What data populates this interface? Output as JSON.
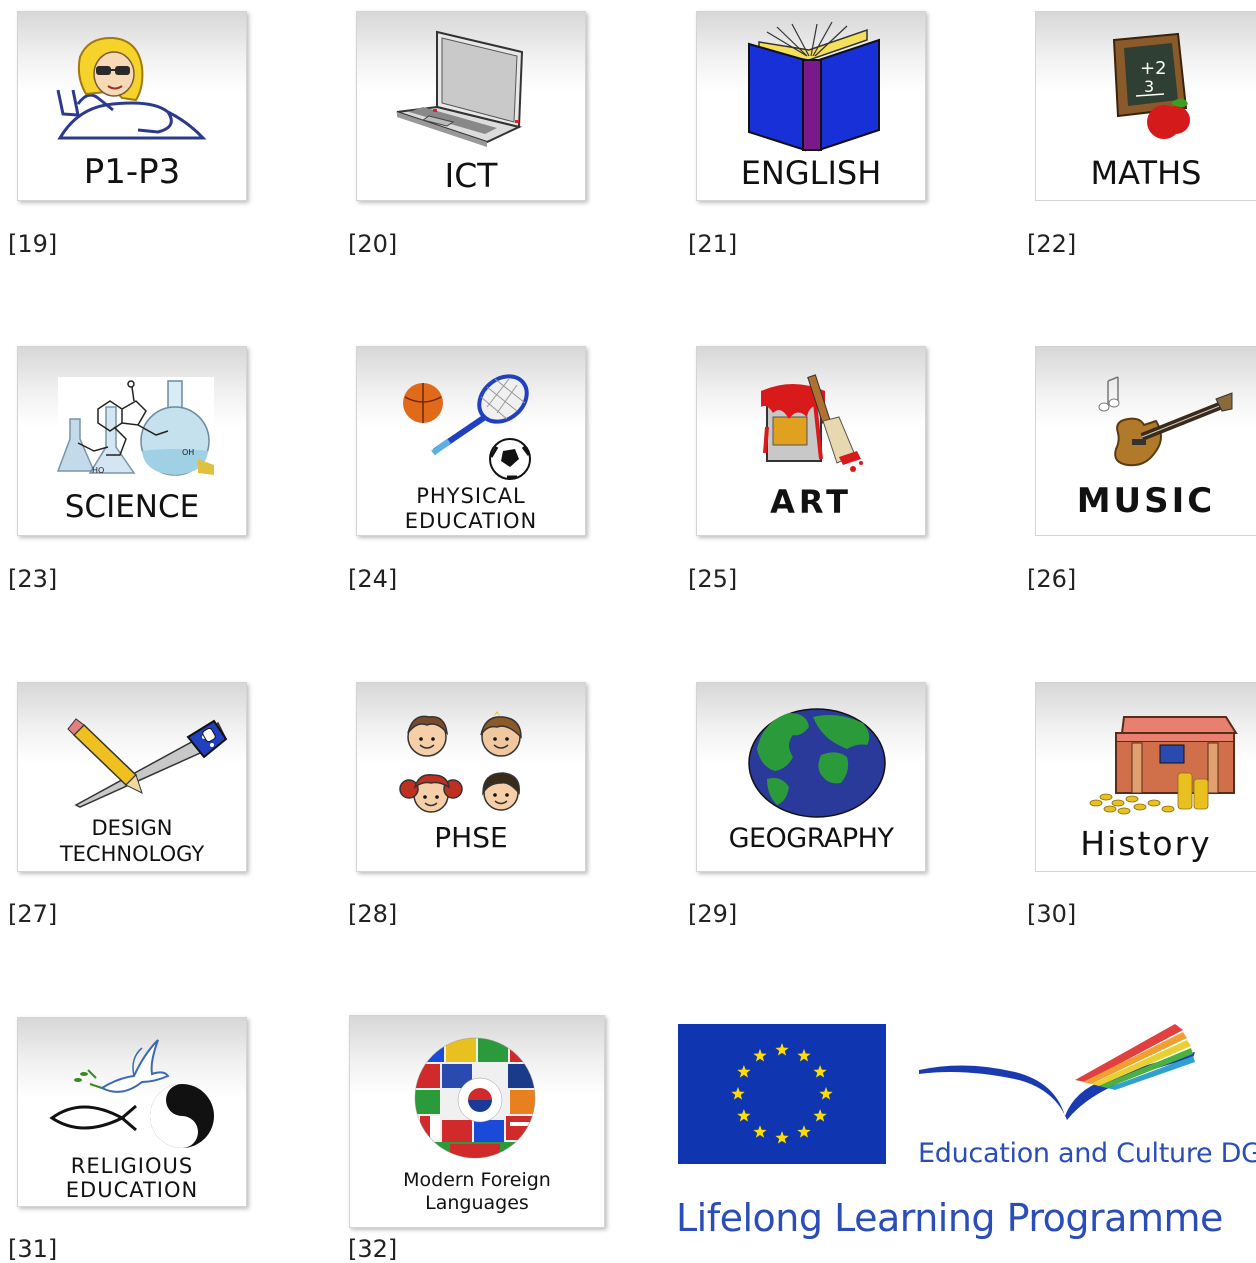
{
  "tiles": [
    {
      "label": "P1-P3",
      "ref": "[19]",
      "icon": "child-icon"
    },
    {
      "label": "ICT",
      "ref": "[20]",
      "icon": "laptop-icon"
    },
    {
      "label": "ENGLISH",
      "ref": "[21]",
      "icon": "book-icon"
    },
    {
      "label": "MATHS",
      "ref": "[22]",
      "icon": "chalkboard-apple-icon",
      "board_lines": [
        "+2",
        "3"
      ]
    },
    {
      "label": "SCIENCE",
      "ref": "[23]",
      "icon": "lab-flasks-icon",
      "chem_labels": [
        "HO",
        "OH"
      ]
    },
    {
      "label_lines": [
        "PHYSICAL",
        "EDUCATION"
      ],
      "ref": "[24]",
      "icon": "sports-equipment-icon"
    },
    {
      "label": "ART",
      "ref": "[25]",
      "icon": "paint-can-brush-icon"
    },
    {
      "label": "MUSIC",
      "ref": "[26]",
      "icon": "guitar-icon"
    },
    {
      "label_lines": [
        "DESIGN",
        "TECHNOLOGY"
      ],
      "ref": "[27]",
      "icon": "pencil-saw-icon"
    },
    {
      "label": "PHSE",
      "ref": "[28]",
      "icon": "children-faces-icon"
    },
    {
      "label": "GEOGRAPHY",
      "ref": "[29]",
      "icon": "globe-icon"
    },
    {
      "label": "History",
      "ref": "[30]",
      "icon": "treasure-chest-icon"
    },
    {
      "label_lines": [
        "RELIGIOUS",
        "EDUCATION"
      ],
      "ref": "[31]",
      "icon": "dove-yinyang-fish-icon"
    },
    {
      "label_lines": [
        "Modern Foreign",
        "Languages"
      ],
      "ref": "[32]",
      "icon": "flag-globe-icon"
    }
  ],
  "footer": {
    "dg_text": "Education and Culture DG",
    "programme_text": "Lifelong Learning Programme",
    "eu_flag_color": "#0f35b1",
    "star_color": "#ffdd00",
    "brand_blue": "#2b4db8"
  }
}
